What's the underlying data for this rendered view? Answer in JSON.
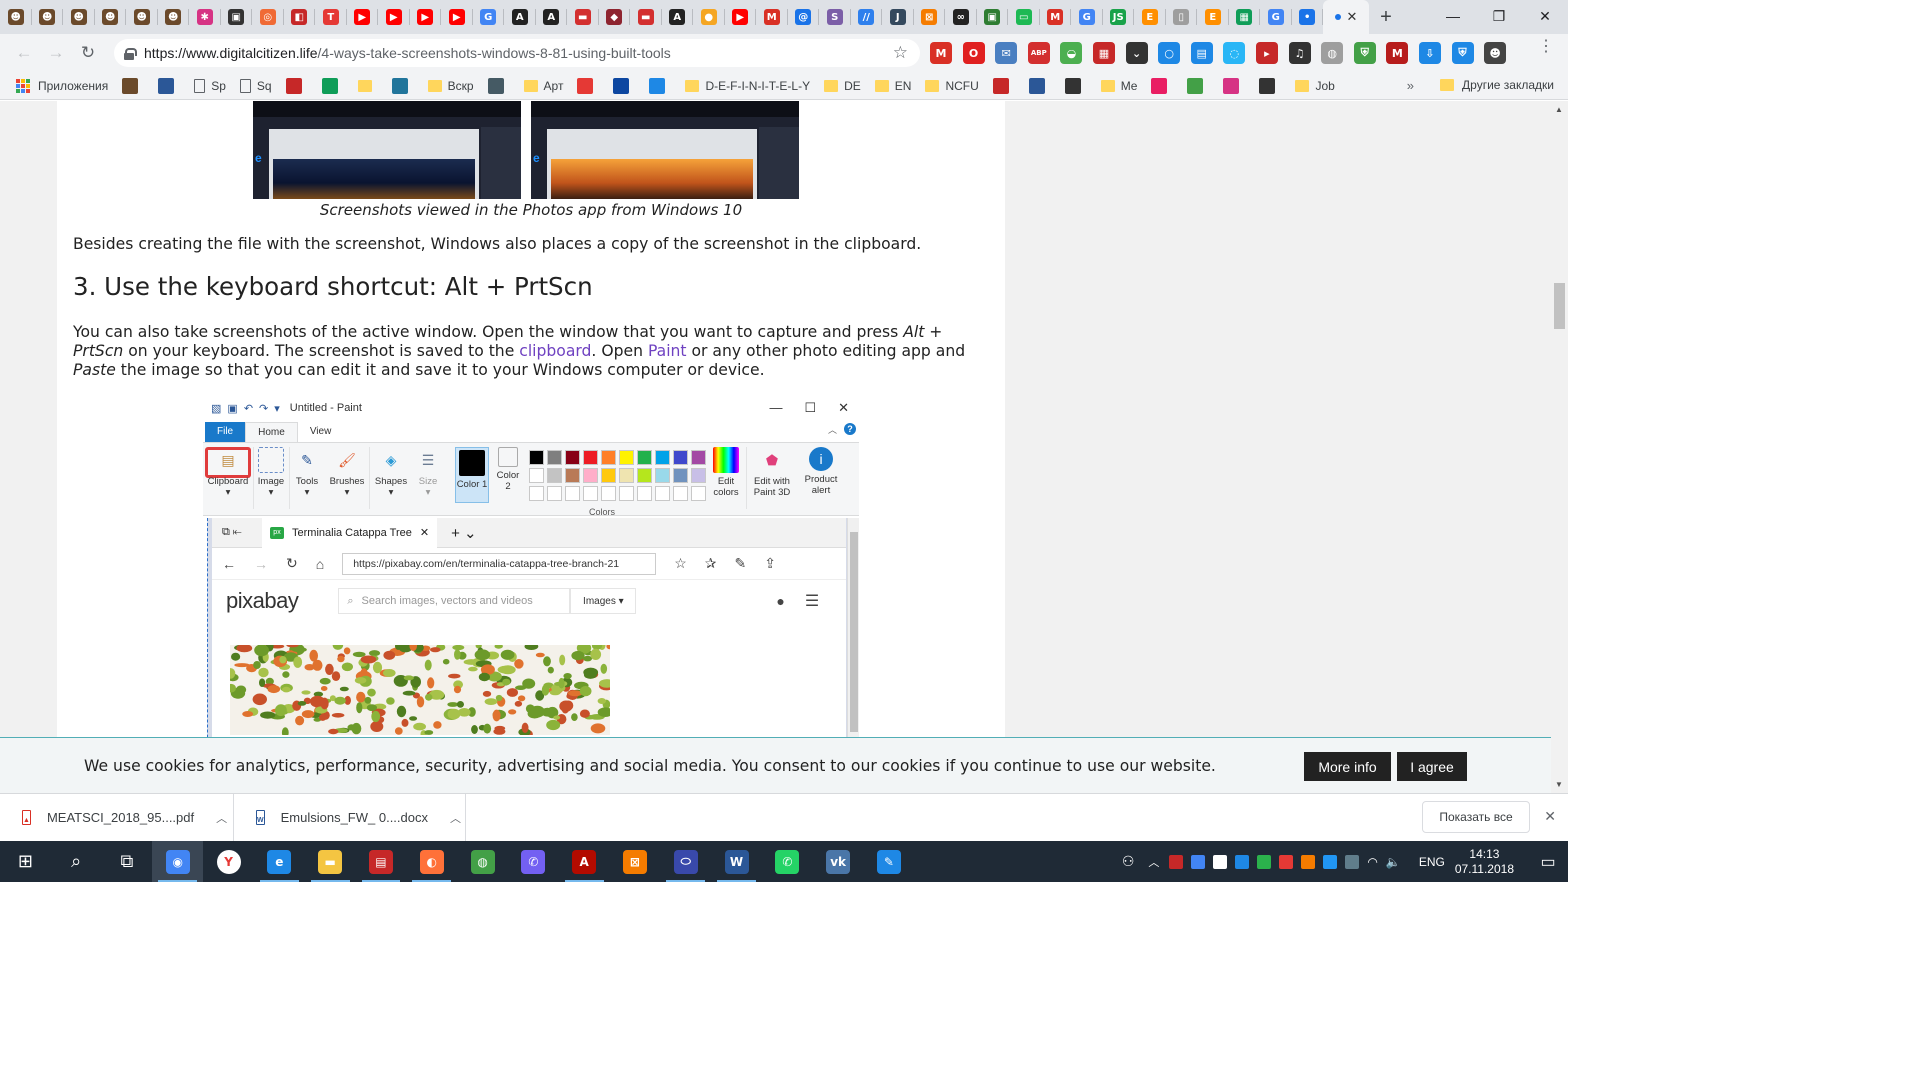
{
  "browser": {
    "tab_close": "✕",
    "new_tab": "+",
    "window_controls": [
      "—",
      "❐",
      "✕"
    ],
    "tabs": [
      {
        "icon": "person-avatar-icon",
        "color": "#6b4a2b",
        "glyph": "☻"
      },
      {
        "icon": "person-avatar-icon",
        "color": "#6b4a2b",
        "glyph": "☻"
      },
      {
        "icon": "person-avatar-icon",
        "color": "#6b4a2b",
        "glyph": "☻"
      },
      {
        "icon": "person-avatar-icon",
        "color": "#6b4a2b",
        "glyph": "☻"
      },
      {
        "icon": "person-avatar-icon",
        "color": "#6b4a2b",
        "glyph": "☻"
      },
      {
        "icon": "person-avatar-icon",
        "color": "#6b4a2b",
        "glyph": "☻"
      },
      {
        "icon": "colorful-star-icon",
        "color": "#d63384",
        "glyph": "✱"
      },
      {
        "icon": "car-icon",
        "color": "#333333",
        "glyph": "▣"
      },
      {
        "icon": "circle-icon",
        "color": "#f06a35",
        "glyph": "◎"
      },
      {
        "icon": "gift-icon",
        "color": "#c62828",
        "glyph": "◧"
      },
      {
        "icon": "t-icon",
        "color": "#e53935",
        "glyph": "T"
      },
      {
        "icon": "youtube-icon",
        "color": "#ff0000",
        "glyph": "▶"
      },
      {
        "icon": "youtube-icon",
        "color": "#ff0000",
        "glyph": "▶"
      },
      {
        "icon": "youtube-icon",
        "color": "#ff0000",
        "glyph": "▶"
      },
      {
        "icon": "youtube-icon",
        "color": "#ff0000",
        "glyph": "▶"
      },
      {
        "icon": "google-icon",
        "color": "#4285f4",
        "glyph": "G"
      },
      {
        "icon": "a-icon",
        "color": "#222222",
        "glyph": "A"
      },
      {
        "icon": "a-icon",
        "color": "#222222",
        "glyph": "A"
      },
      {
        "icon": "flag-icon",
        "color": "#d32f2f",
        "glyph": "▬"
      },
      {
        "icon": "shield-icon",
        "color": "#8e2430",
        "glyph": "◆"
      },
      {
        "icon": "flag-icon",
        "color": "#d32f2f",
        "glyph": "▬"
      },
      {
        "icon": "a-icon",
        "color": "#222222",
        "glyph": "A"
      },
      {
        "icon": "orange-circle-icon",
        "color": "#f5a623",
        "glyph": "●"
      },
      {
        "icon": "youtube-icon",
        "color": "#ff0000",
        "glyph": "▶"
      },
      {
        "icon": "gmail-icon",
        "color": "#d93025",
        "glyph": "M"
      },
      {
        "icon": "at-icon",
        "color": "#1a73e8",
        "glyph": "@"
      },
      {
        "icon": "s-icon",
        "color": "#7b5ea7",
        "glyph": "S"
      },
      {
        "icon": "w-icon",
        "color": "#2f80ed",
        "glyph": "//"
      },
      {
        "icon": "j-icon",
        "color": "#34495e",
        "glyph": "J"
      },
      {
        "icon": "network-icon",
        "color": "#f57c00",
        "glyph": "⊠"
      },
      {
        "icon": "glasses-icon",
        "color": "#222222",
        "glyph": "∞"
      },
      {
        "icon": "app-icon",
        "color": "#2e7d32",
        "glyph": "▣"
      },
      {
        "icon": "message-icon",
        "color": "#1db954",
        "glyph": "▭"
      },
      {
        "icon": "gmail-icon",
        "color": "#d93025",
        "glyph": "M"
      },
      {
        "icon": "google-icon",
        "color": "#4285f4",
        "glyph": "G"
      },
      {
        "icon": "js-icon",
        "color": "#19a24a",
        "glyph": "JS"
      },
      {
        "icon": "e-icon",
        "color": "#ff8f00",
        "glyph": "E"
      },
      {
        "icon": "document-icon",
        "color": "#9e9e9e",
        "glyph": "▯"
      },
      {
        "icon": "e-icon",
        "color": "#ff8f00",
        "glyph": "E"
      },
      {
        "icon": "sheets-icon",
        "color": "#0f9d58",
        "glyph": "▦"
      },
      {
        "icon": "google-icon",
        "color": "#4285f4",
        "glyph": "G"
      },
      {
        "icon": "dot-icon",
        "color": "#1a73e8",
        "glyph": "•"
      }
    ],
    "toolbar": {
      "back": "←",
      "forward": "→",
      "reload": "↻",
      "url_host": "https://www.digitalcitizen.life",
      "url_path": "/4-ways-take-screenshots-windows-8-81-using-built-tools",
      "bookmark_star": "☆",
      "menu": "⋮"
    },
    "extensions": [
      {
        "icon": "gmail-icon",
        "color": "#d93025",
        "glyph": "M"
      },
      {
        "icon": "opera-icon",
        "color": "#e02020",
        "glyph": "O"
      },
      {
        "icon": "mail-icon",
        "color": "#4a7fc1",
        "glyph": "✉"
      },
      {
        "icon": "adblock-icon",
        "color": "#d32f2f",
        "glyph": "ABP"
      },
      {
        "icon": "basket-icon",
        "color": "#4caf50",
        "glyph": "◒"
      },
      {
        "icon": "grid-icon",
        "color": "#c62828",
        "glyph": "▦"
      },
      {
        "icon": "pocket-icon",
        "color": "#333333",
        "glyph": "⌄"
      },
      {
        "icon": "circle-icon",
        "color": "#1e88e5",
        "glyph": "○"
      },
      {
        "icon": "window-icon",
        "color": "#1e88e5",
        "glyph": "▤"
      },
      {
        "icon": "sync-icon",
        "color": "#29b6f6",
        "glyph": "◌"
      },
      {
        "icon": "play-icon",
        "color": "#c62828",
        "glyph": "▸"
      },
      {
        "icon": "music-icon",
        "color": "#333333",
        "glyph": "♫"
      },
      {
        "icon": "globe-icon",
        "color": "#9e9e9e",
        "glyph": "◍"
      },
      {
        "icon": "shield-icon",
        "color": "#43a047",
        "glyph": "⛨"
      },
      {
        "icon": "mm-icon",
        "color": "#b71c1c",
        "glyph": "M"
      },
      {
        "icon": "download-icon",
        "color": "#1e88e5",
        "glyph": "⇩"
      },
      {
        "icon": "shield-icon",
        "color": "#1e88e5",
        "glyph": "⛨"
      },
      {
        "icon": "profile-icon",
        "color": "#444444",
        "glyph": "☻"
      }
    ],
    "bookmarks": {
      "apps_label": "Приложения",
      "items": [
        {
          "type": "icon",
          "label": "",
          "color": "#6b4a2b"
        },
        {
          "type": "icon",
          "label": "",
          "color": "#2b5797"
        },
        {
          "type": "doc",
          "label": "Sp"
        },
        {
          "type": "doc",
          "label": "Sq"
        },
        {
          "type": "icon",
          "label": "",
          "color": "#c62828"
        },
        {
          "type": "icon",
          "label": "",
          "color": "#0f9d58"
        },
        {
          "type": "folder",
          "label": ""
        },
        {
          "type": "icon",
          "label": "",
          "color": "#21759b"
        },
        {
          "type": "folder",
          "label": "Вскр"
        },
        {
          "type": "icon",
          "label": "",
          "color": "#455a64"
        },
        {
          "type": "folder",
          "label": "Арт"
        },
        {
          "type": "icon",
          "label": "",
          "color": "#e53935"
        },
        {
          "type": "icon",
          "label": "",
          "color": "#0d47a1"
        },
        {
          "type": "icon",
          "label": "",
          "color": "#1e88e5"
        },
        {
          "type": "folder",
          "label": "D-E-F-I-N-I-T-E-L-Y"
        },
        {
          "type": "folder",
          "label": "DE"
        },
        {
          "type": "folder",
          "label": "EN"
        },
        {
          "type": "folder",
          "label": "NCFU"
        },
        {
          "type": "icon",
          "label": "",
          "color": "#c62828"
        },
        {
          "type": "icon",
          "label": "",
          "color": "#2b5797"
        },
        {
          "type": "icon",
          "label": "",
          "color": "#333333"
        },
        {
          "type": "folder",
          "label": "Me"
        },
        {
          "type": "icon",
          "label": "",
          "color": "#e91e63"
        },
        {
          "type": "icon",
          "label": "",
          "color": "#43a047"
        },
        {
          "type": "icon",
          "label": "",
          "color": "#d63384"
        },
        {
          "type": "icon",
          "label": "",
          "color": "#333333"
        },
        {
          "type": "folder",
          "label": "Job"
        }
      ],
      "more": "»",
      "other_label": "Другие закладки"
    }
  },
  "article": {
    "caption": "Screenshots viewed in the Photos app from Windows 10",
    "p1": "Besides creating the file with the screenshot, Windows also places a copy of the screenshot in the clipboard.",
    "heading": "3. Use the keyboard shortcut: Alt + PrtScn",
    "p2_a": "You can also take screenshots of the active window. Open the window that you want to capture and press ",
    "p2_b": "Alt + PrtScn",
    "p2_c": " on your keyboard. The screenshot is saved to the ",
    "p2_link1": "clipboard",
    "p2_d": ". Open ",
    "p2_link2": "Paint",
    "p2_e": " or any other photo editing app and ",
    "p2_f": "Paste",
    "p2_g": " the image so that you can edit it and save it to your Windows computer or device.",
    "paint": {
      "title": "Untitled - Paint",
      "tabs": [
        "File",
        "Home",
        "View"
      ],
      "groups": [
        "Clipboard",
        "Image",
        "Tools",
        "Brushes",
        "Shapes",
        "Size",
        "Color 1",
        "Color 2",
        "Edit colors",
        "Edit with Paint 3D",
        "Product alert"
      ],
      "colors_label": "Colors",
      "palette": [
        "#000000",
        "#7f7f7f",
        "#880015",
        "#ed1c24",
        "#ff7f27",
        "#fff200",
        "#22b14c",
        "#00a2e8",
        "#3f48cc",
        "#a349a4",
        "#ffffff",
        "#c3c3c3",
        "#b97a57",
        "#ffaec9",
        "#ffc90e",
        "#efe4b0",
        "#b5e61d",
        "#99d9ea",
        "#7092be",
        "#c8bfe7"
      ],
      "edge_tab": "Terminalia Catappa Tree",
      "edge_url": "https://pixabay.com/en/terminalia-catappa-tree-branch-21",
      "site_logo": "pixabay",
      "search_placeholder": "Search images, vectors and videos",
      "images_select": "Images ▾"
    }
  },
  "cookie": {
    "text": "We use cookies for analytics, performance, security, advertising and social media. You consent to our cookies if you continue to use our website.",
    "more_info": "More info",
    "agree": "I agree"
  },
  "downloads": {
    "items": [
      {
        "name": "MEATSCI_2018_95....pdf",
        "icon": "pdf-file-icon",
        "color": "#d93025"
      },
      {
        "name": "Emulsions_FW_ 0....docx",
        "icon": "word-file-icon",
        "color": "#2b5797"
      }
    ],
    "show_all": "Показать все",
    "close": "✕"
  },
  "taskbar": {
    "apps": [
      {
        "icon": "start-icon",
        "color": "#1f2a36",
        "glyph": "⊞"
      },
      {
        "icon": "search-icon",
        "color": "#1f2a36",
        "glyph": "⌕"
      },
      {
        "icon": "task-view-icon",
        "color": "#1f2a36",
        "glyph": "⧉"
      },
      {
        "icon": "chrome-icon",
        "color": "#4285f4",
        "glyph": "◉"
      },
      {
        "icon": "yandex-browser-icon",
        "color": "#ffffff",
        "glyph": "Y"
      },
      {
        "icon": "edge-icon",
        "color": "#1e88e5",
        "glyph": "e"
      },
      {
        "icon": "file-explorer-icon",
        "color": "#f4c542",
        "glyph": "▬"
      },
      {
        "icon": "red-app-icon",
        "color": "#c62828",
        "glyph": "▤"
      },
      {
        "icon": "firefox-icon",
        "color": "#ff7139",
        "glyph": "◐"
      },
      {
        "icon": "globe-app-icon",
        "color": "#43a047",
        "glyph": "◍"
      },
      {
        "icon": "viber-icon",
        "color": "#7360f2",
        "glyph": "✆"
      },
      {
        "icon": "acrobat-icon",
        "color": "#b30b00",
        "glyph": "A"
      },
      {
        "icon": "network-app-icon",
        "color": "#f57c00",
        "glyph": "⊠"
      },
      {
        "icon": "pill-app-icon",
        "color": "#3949ab",
        "glyph": "⬭"
      },
      {
        "icon": "word-icon",
        "color": "#2b5797",
        "glyph": "W"
      },
      {
        "icon": "whatsapp-icon",
        "color": "#25d366",
        "glyph": "✆"
      },
      {
        "icon": "vk-icon",
        "color": "#4a76a8",
        "glyph": "vk"
      },
      {
        "icon": "pen-app-icon",
        "color": "#1e88e5",
        "glyph": "✎"
      }
    ],
    "tray_colors": [
      "#c62828",
      "#4285f4",
      "#ffffff",
      "#1e88e5",
      "#2bb24c",
      "#e53935",
      "#f57c00",
      "#2196f3",
      "#607d8b"
    ],
    "lang": "ENG",
    "time": "14:13",
    "date": "07.11.2018"
  }
}
